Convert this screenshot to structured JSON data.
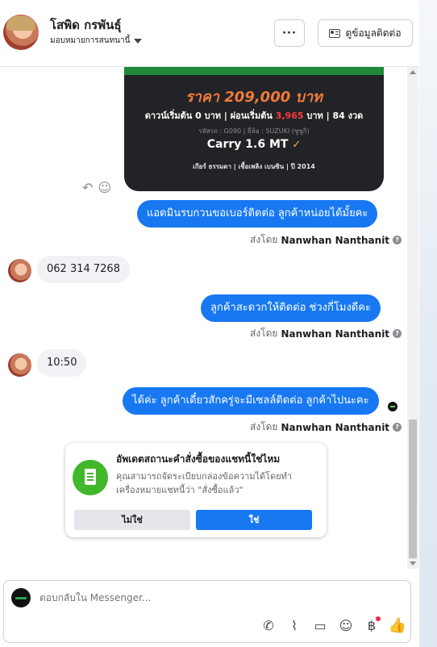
{
  "header": {
    "contact_name": "โสพิด กรพันธุ์",
    "assign_label": "มอบหมายการสนทนานี้",
    "more_label": "···",
    "view_contact_label": "ดูข้อมูลติดต่อ"
  },
  "product_image": {
    "price": "ราคา 209,000 บาท",
    "down_prefix": "ดาวน์เริ่มต้น 0 บาท | ผ่อนเริ่มต้น",
    "monthly": "3,965",
    "down_suffix": "บาท | 84 งวด",
    "codes": "รหัสรถ : G090 | ยี่ห้อ : SUZUKI (ซูซูกิ)",
    "model": "Carry 1.6 MT",
    "specs": "เกียร์ ธรรมดา  |  เชื้อเพลิง เบนซิน  |  ปี 2014"
  },
  "messages": [
    {
      "direction": "out",
      "text": "แอดมินรบกวนขอเบอร์ติดต่อ ลูกค้าหน่อยได้มั้ยคะ",
      "sent_by_prefix": "ส่งโดย",
      "sent_by": "Nanwhan Nanthanit"
    },
    {
      "direction": "in",
      "text": "062 314  7268"
    },
    {
      "direction": "out",
      "text": "ลูกค้าสะดวกให้ติดต่อ ช่วงกี่โมงดีคะ",
      "sent_by_prefix": "ส่งโดย",
      "sent_by": "Nanwhan Nanthanit"
    },
    {
      "direction": "in",
      "text": "10:50"
    },
    {
      "direction": "out",
      "text": "ได้ค่ะ ลูกค้าเดี๋ยวสักครู่จะมีเซลล์ติดต่อ ลูกค้าไปนะคะ",
      "sent_by_prefix": "ส่งโดย",
      "sent_by": "Nanwhan Nanthanit"
    }
  ],
  "update_card": {
    "title": "อัพเดตสถานะคำสั่งซื้อของแชทนี้ใช่ไหม",
    "description": "คุณสามารถจัดระเบียบกล่องข้อความได้โดยทำเครื่องหมายแชทนี้ว่า \"สั่งซื้อแล้ว\"",
    "no_label": "ไม่ใช่",
    "yes_label": "ใช่"
  },
  "composer": {
    "placeholder": "ตอบกลับใน Messenger..."
  },
  "icons": {
    "more": "more-dots-icon",
    "contact_card": "contact-card-icon",
    "reply": "reply-icon",
    "emoji_react": "emoji-icon",
    "help": "question-icon",
    "call": "call-add-icon",
    "attach": "paperclip-icon",
    "saved_reply": "saved-reply-icon",
    "emoji": "emoji-icon",
    "payment": "baht-icon",
    "like": "thumbs-up-icon"
  },
  "colors": {
    "outgoing_bubble": "#1778f2",
    "incoming_bubble": "#f0f2f5",
    "confirm_button": "#1778f2",
    "card_icon": "#42b72a",
    "price": "#f07a3a",
    "notification_dot": "#f02849"
  }
}
